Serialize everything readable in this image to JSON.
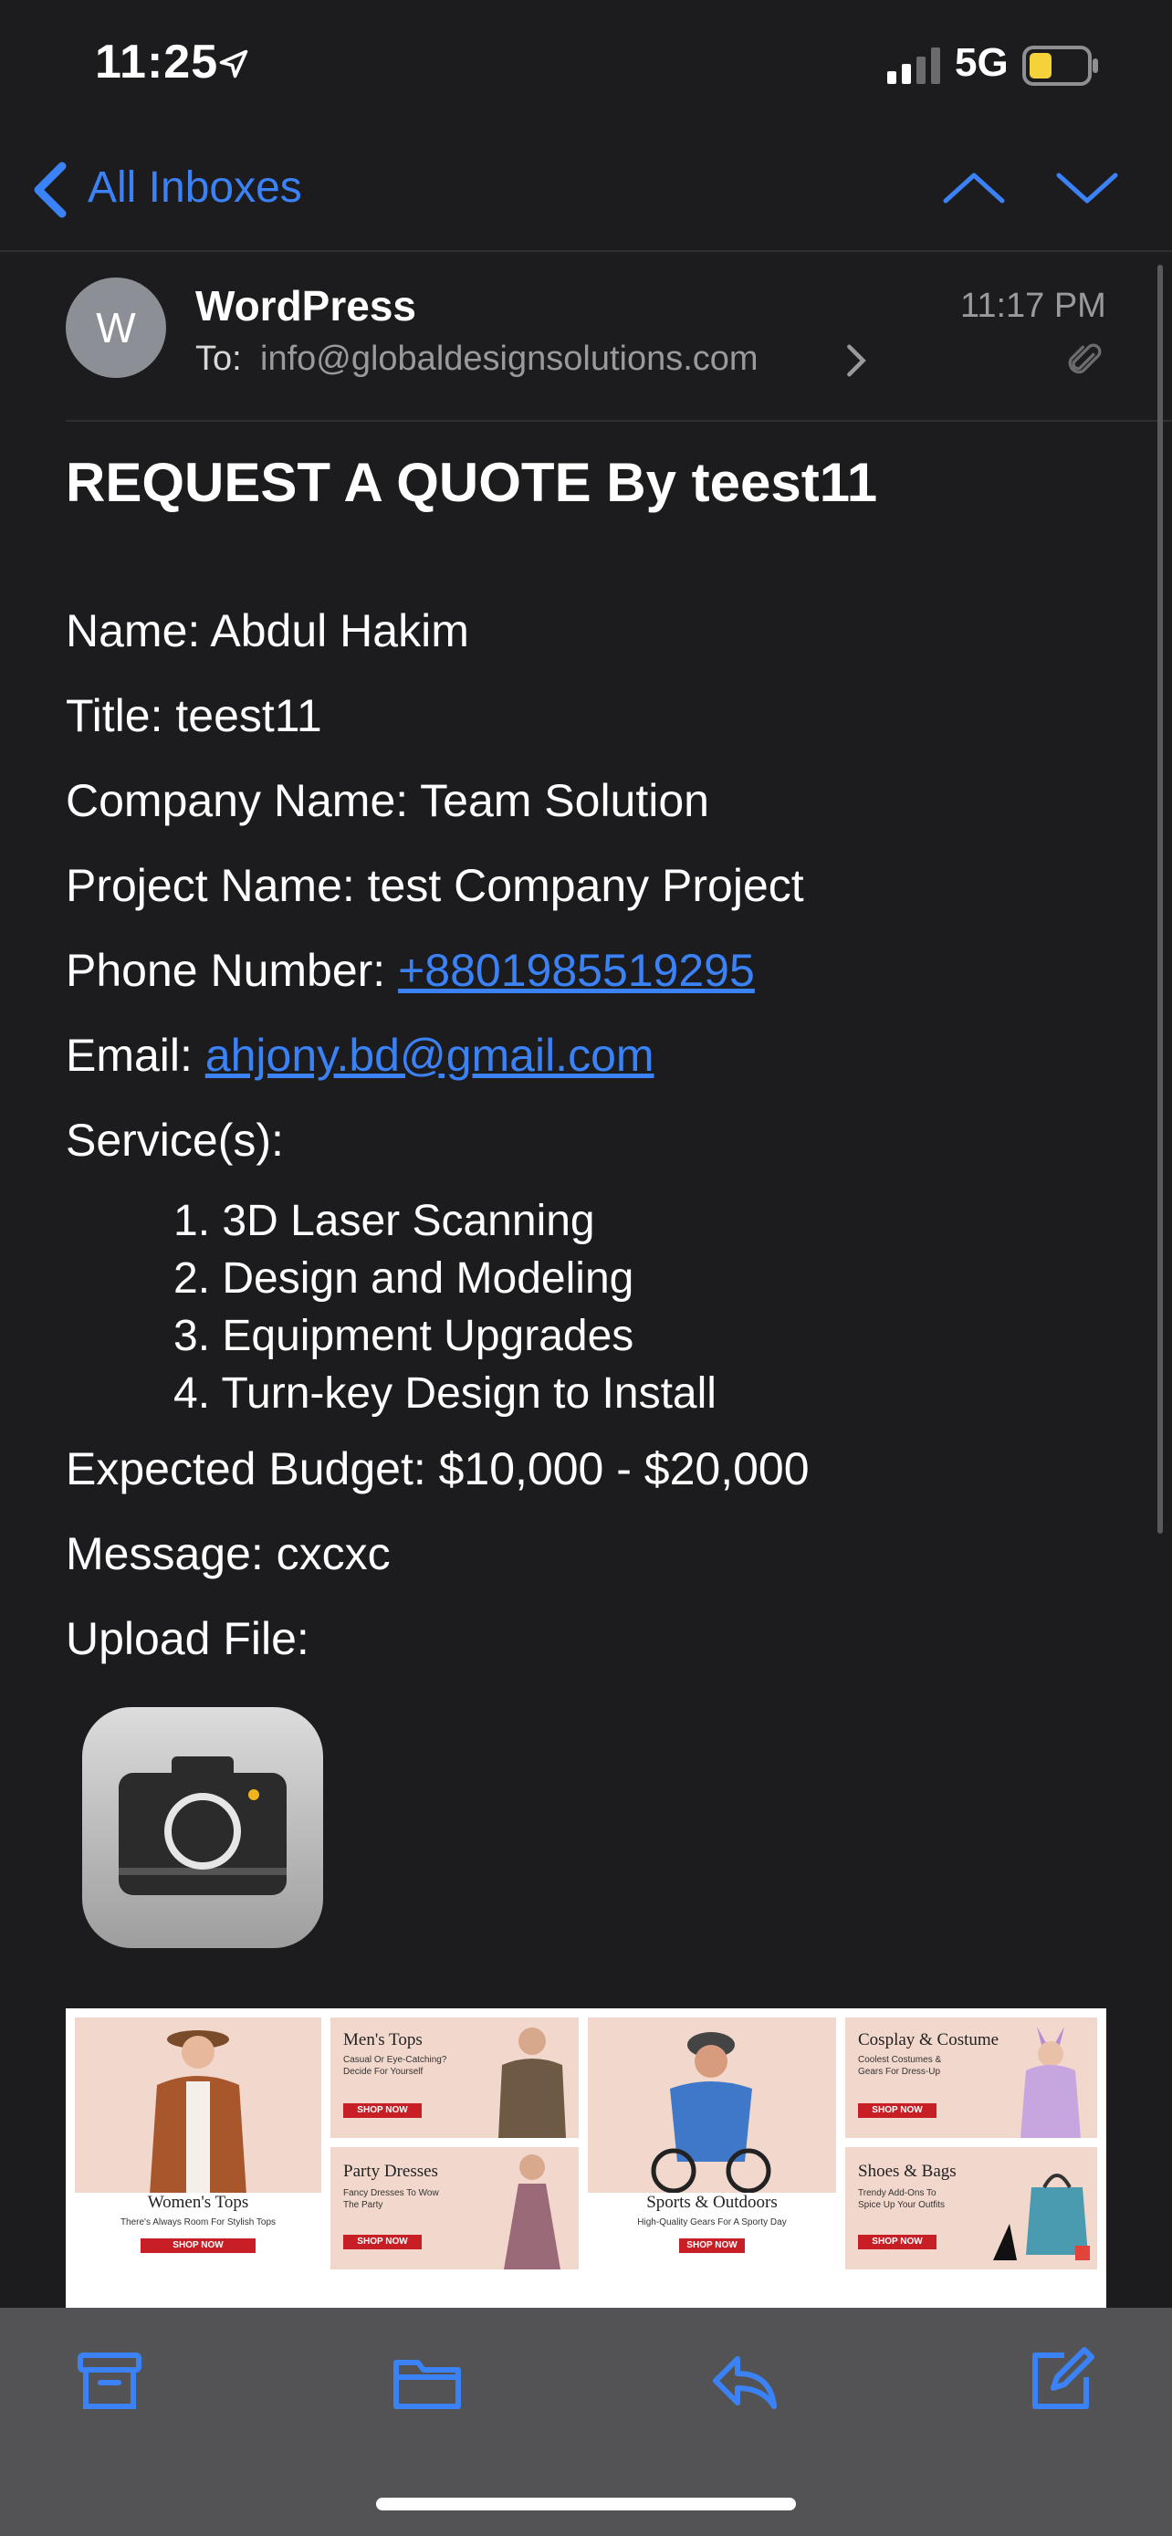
{
  "status_bar": {
    "time": "11:25",
    "network": "5G"
  },
  "nav": {
    "back_label": "All Inboxes"
  },
  "header": {
    "avatar_initial": "W",
    "sender": "WordPress",
    "to_label": "To:",
    "to_address": "info@globaldesignsolutions.com",
    "time": "11:17 PM"
  },
  "email": {
    "subject": "REQUEST A QUOTE By teest11",
    "name": "Name: Abdul Hakim",
    "title": "Title: teest11",
    "company": "Company Name: Team Solution",
    "project": "Project Name: test Company Project",
    "phone_label": "Phone Number: ",
    "phone": "+8801985519295",
    "email_label": "Email: ",
    "email": "ahjony.bd@gmail.com",
    "services_label": "Service(s):",
    "services": [
      "1. 3D Laser Scanning",
      "2. Design and Modeling",
      "3. Equipment Upgrades",
      "4. Turn-key Design to Install"
    ],
    "budget": "Expected Budget: $10,000 - $20,000",
    "message": "Message: cxcxc",
    "upload_label": "Upload File:"
  },
  "banner": {
    "cards": [
      {
        "title": "Women's Tops",
        "sub": "There's Always Room For Stylish Tops",
        "cta": "SHOP NOW"
      },
      {
        "title": "Men's Tops",
        "sub": "Casual Or Eye-Catching? Decide For Yourself",
        "cta": "SHOP NOW"
      },
      {
        "title": "Party Dresses",
        "sub": "Fancy Dresses To Wow The Party",
        "cta": "SHOP NOW"
      },
      {
        "title": "Sports & Outdoors",
        "sub": "High-Quality Gears For A Sporty Day",
        "cta": "SHOP NOW"
      },
      {
        "title": "Cosplay & Costume",
        "sub": "Coolest Costumes & Gears For Dress-Up",
        "cta": "SHOP NOW"
      },
      {
        "title": "Shoes & Bags",
        "sub": "Trendy Add-Ons To Spice Up Your Outfits",
        "cta": "SHOP NOW"
      }
    ]
  },
  "colors": {
    "background": "#1c1c1e",
    "accent": "#3b82f6",
    "toolbar": "#535356"
  },
  "icons": [
    "location-arrow-icon",
    "signal-icon",
    "battery-icon",
    "back-chevron-icon",
    "up-arrow-icon",
    "down-arrow-icon",
    "paperclip-icon",
    "camera-icon",
    "archive-icon",
    "folder-icon",
    "reply-icon",
    "compose-icon"
  ]
}
